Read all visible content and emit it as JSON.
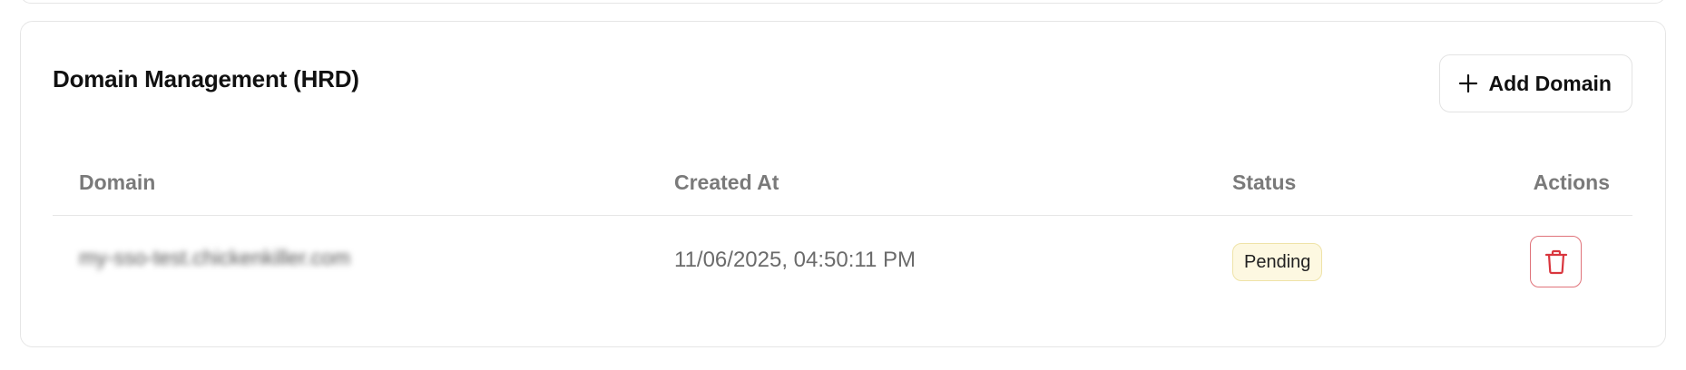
{
  "card": {
    "title": "Domain Management (HRD)",
    "add_button_label": "Add Domain"
  },
  "table": {
    "columns": [
      "Domain",
      "Created At",
      "Status",
      "Actions"
    ],
    "rows": [
      {
        "domain": "my-sso-test.chickenkiller.com",
        "created_at": "11/06/2025, 04:50:11 PM",
        "status": "Pending",
        "action_icon": "trash-icon"
      }
    ]
  },
  "colors": {
    "pending_badge_bg": "#fdf8e1",
    "pending_badge_border": "#efe3a8",
    "delete_accent": "#d9363e",
    "header_text": "#7a7a7a"
  },
  "icons": {
    "add": "plus-icon",
    "delete": "trash-icon"
  }
}
